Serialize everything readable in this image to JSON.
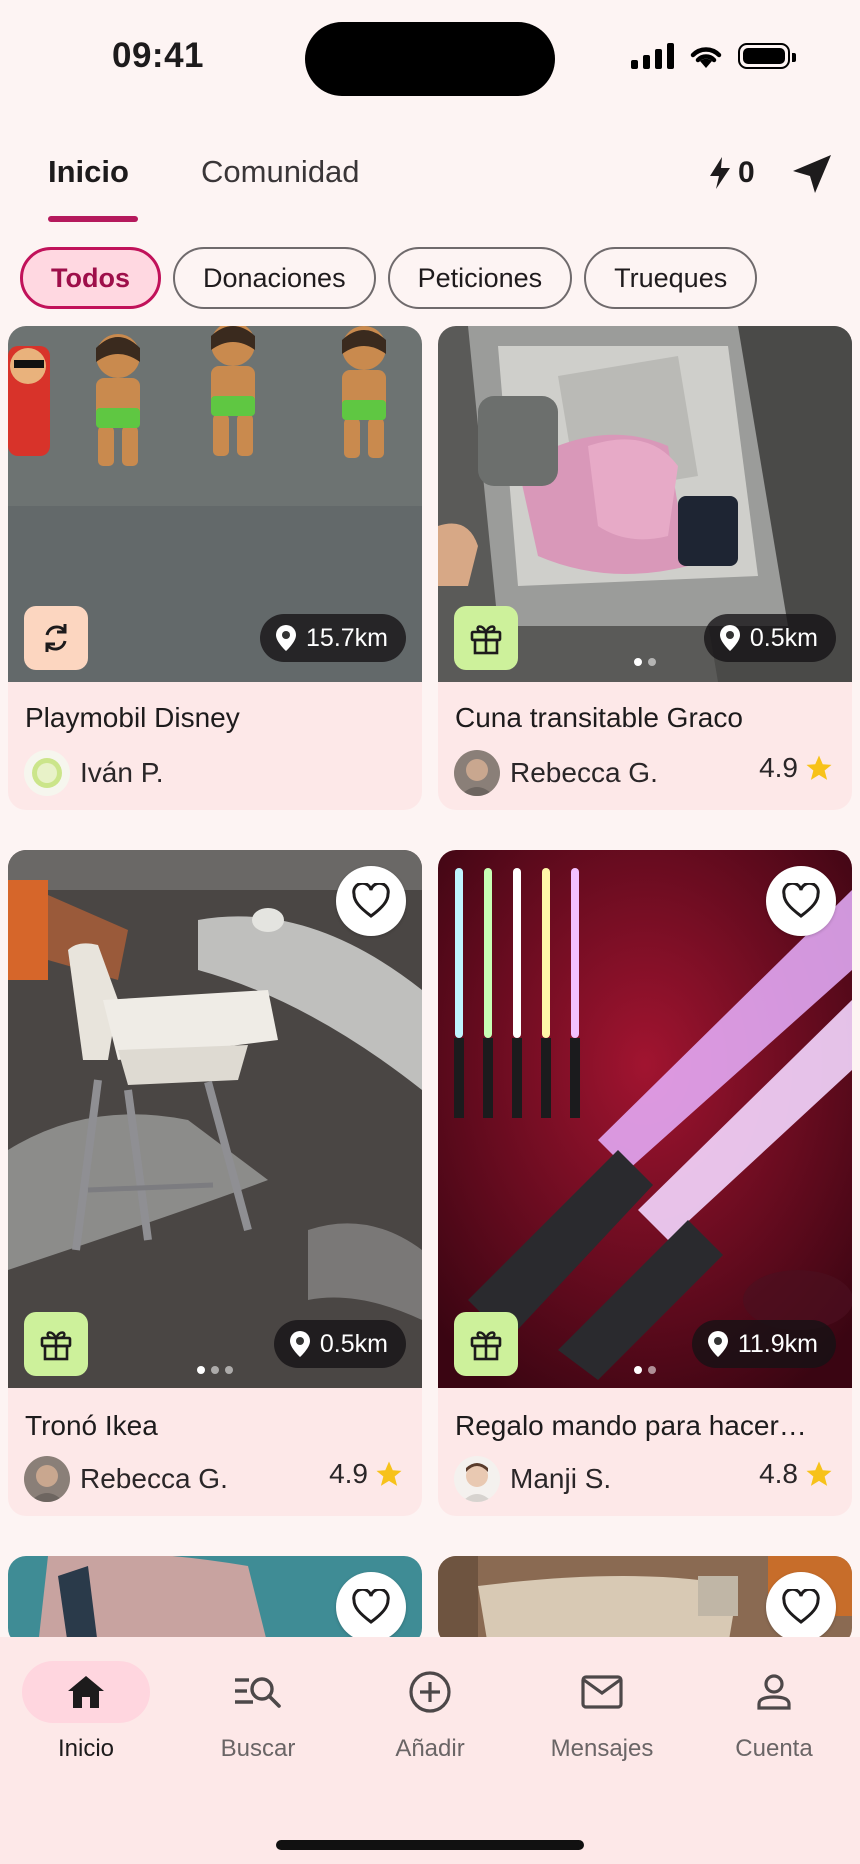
{
  "status_bar": {
    "time": "09:41"
  },
  "header": {
    "tabs": [
      {
        "label": "Inicio",
        "active": true
      },
      {
        "label": "Comunidad",
        "active": false
      }
    ],
    "points": "0"
  },
  "filters": [
    {
      "label": "Todos",
      "active": true
    },
    {
      "label": "Donaciones",
      "active": false
    },
    {
      "label": "Peticiones",
      "active": false
    },
    {
      "label": "Trueques",
      "active": false
    }
  ],
  "listings": [
    {
      "title": "Playmobil Disney",
      "user": "Iván P.",
      "rating": "",
      "distance": "15.7km",
      "type": "swap-icon",
      "favorite_visible": false,
      "image_pages": 0
    },
    {
      "title": "Cuna transitable Graco",
      "user": "Rebecca G.",
      "rating": "4.9",
      "distance": "0.5km",
      "type": "gift-icon",
      "favorite_visible": false,
      "image_pages": 2
    },
    {
      "title": "Tronó Ikea",
      "user": "Rebecca G.",
      "rating": "4.9",
      "distance": "0.5km",
      "type": "gift-icon",
      "favorite_visible": true,
      "image_pages": 3
    },
    {
      "title": "Regalo mando para hacer…",
      "user": "Manji S.",
      "rating": "4.8",
      "distance": "11.9km",
      "type": "gift-icon",
      "favorite_visible": true,
      "image_pages": 2
    }
  ],
  "bottom_nav": [
    {
      "label": "Inicio",
      "icon": "home-icon",
      "active": true
    },
    {
      "label": "Buscar",
      "icon": "search-icon",
      "active": false
    },
    {
      "label": "Añadir",
      "icon": "add-icon",
      "active": false
    },
    {
      "label": "Mensajes",
      "icon": "mail-icon",
      "active": false
    },
    {
      "label": "Cuenta",
      "icon": "account-icon",
      "active": false
    }
  ],
  "colors": {
    "accent": "#b5195c",
    "chip_active_bg": "#ffd8e1",
    "card_bg": "#fde8e8",
    "gift_badge": "#cdf19b",
    "swap_badge": "#fcd6c0",
    "star": "#f7c21a"
  }
}
